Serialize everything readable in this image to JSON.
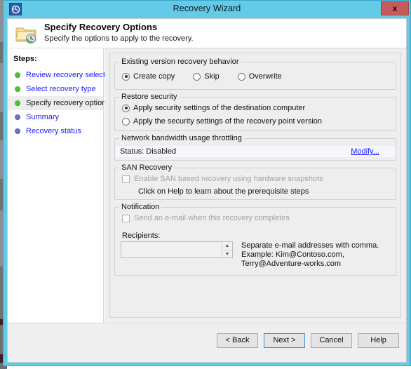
{
  "window": {
    "title": "Recovery Wizard",
    "app_icon": "recovery-clock-icon",
    "close_label": "x"
  },
  "header": {
    "icon": "folder-clock-icon",
    "title": "Specify Recovery Options",
    "subtitle": "Specify the options to apply to the recovery."
  },
  "sidebar": {
    "label": "Steps:",
    "items": [
      {
        "label": "Review recovery selection",
        "state": "done"
      },
      {
        "label": "Select recovery type",
        "state": "done"
      },
      {
        "label": "Specify recovery options",
        "state": "current"
      },
      {
        "label": "Summary",
        "state": "future"
      },
      {
        "label": "Recovery status",
        "state": "future"
      }
    ]
  },
  "main": {
    "existing_version": {
      "title": "Existing version recovery behavior",
      "options": [
        {
          "label": "Create copy",
          "checked": true
        },
        {
          "label": "Skip",
          "checked": false
        },
        {
          "label": "Overwrite",
          "checked": false
        }
      ]
    },
    "restore_security": {
      "title": "Restore security",
      "options": [
        {
          "label": "Apply security settings of the destination computer",
          "checked": true
        },
        {
          "label": "Apply the security settings of the recovery point version",
          "checked": false
        }
      ]
    },
    "throttling": {
      "title": "Network bandwidth usage throttling",
      "status": "Status: Disabled",
      "modify_link": "Modify..."
    },
    "san_recovery": {
      "title": "SAN Recovery",
      "checkbox_label": "Enable SAN based recovery using hardware snapshots",
      "checkbox_checked": false,
      "checkbox_disabled": true,
      "hint": "Click on Help to learn about the prerequisite steps"
    },
    "notification": {
      "title": "Notification",
      "checkbox_label": "Send an e-mail when this recovery completes",
      "checkbox_checked": false,
      "checkbox_disabled": true,
      "recipients_label": "Recipients:",
      "recipients_value": "",
      "desc_line1": "Separate e-mail addresses with comma.",
      "desc_line2": "Example: Kim@Contoso.com, Terry@Adventure-works.com",
      "spin_up": "▲",
      "spin_down": "▼"
    }
  },
  "footer": {
    "back": "< Back",
    "next": "Next >",
    "cancel": "Cancel",
    "help": "Help"
  },
  "colors": {
    "title_bar": "#63cbe8",
    "close_button": "#c75b5b",
    "link": "#1a1aff",
    "step_done": "#52c234",
    "step_future": "#6d6fc4",
    "panel": "#eeeeee"
  }
}
